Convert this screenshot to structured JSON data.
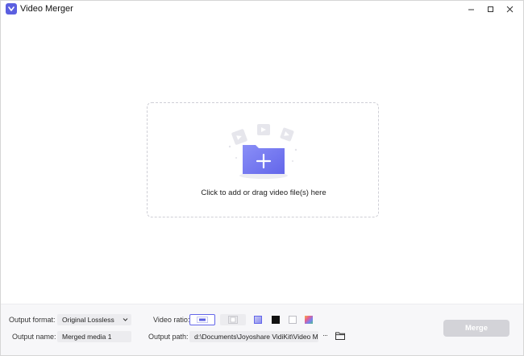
{
  "window": {
    "title": "Video Merger"
  },
  "dropzone": {
    "text": "Click to add or drag video file(s) here"
  },
  "settings": {
    "output_format_label": "Output format:",
    "output_format_value": "Original Lossless",
    "output_name_label": "Output name:",
    "output_name_value": "Merged media 1",
    "video_ratio_label": "Video ratio:",
    "output_path_label": "Output path:",
    "output_path_value": "d:\\Documents\\Joyoshare VidiKit\\Video Merg",
    "browse_more": "···",
    "merge_label": "Merge"
  },
  "colors": {
    "accent": "#5b5fe0",
    "merge_disabled": "#d3d3d8",
    "field_bg": "#ececef"
  }
}
